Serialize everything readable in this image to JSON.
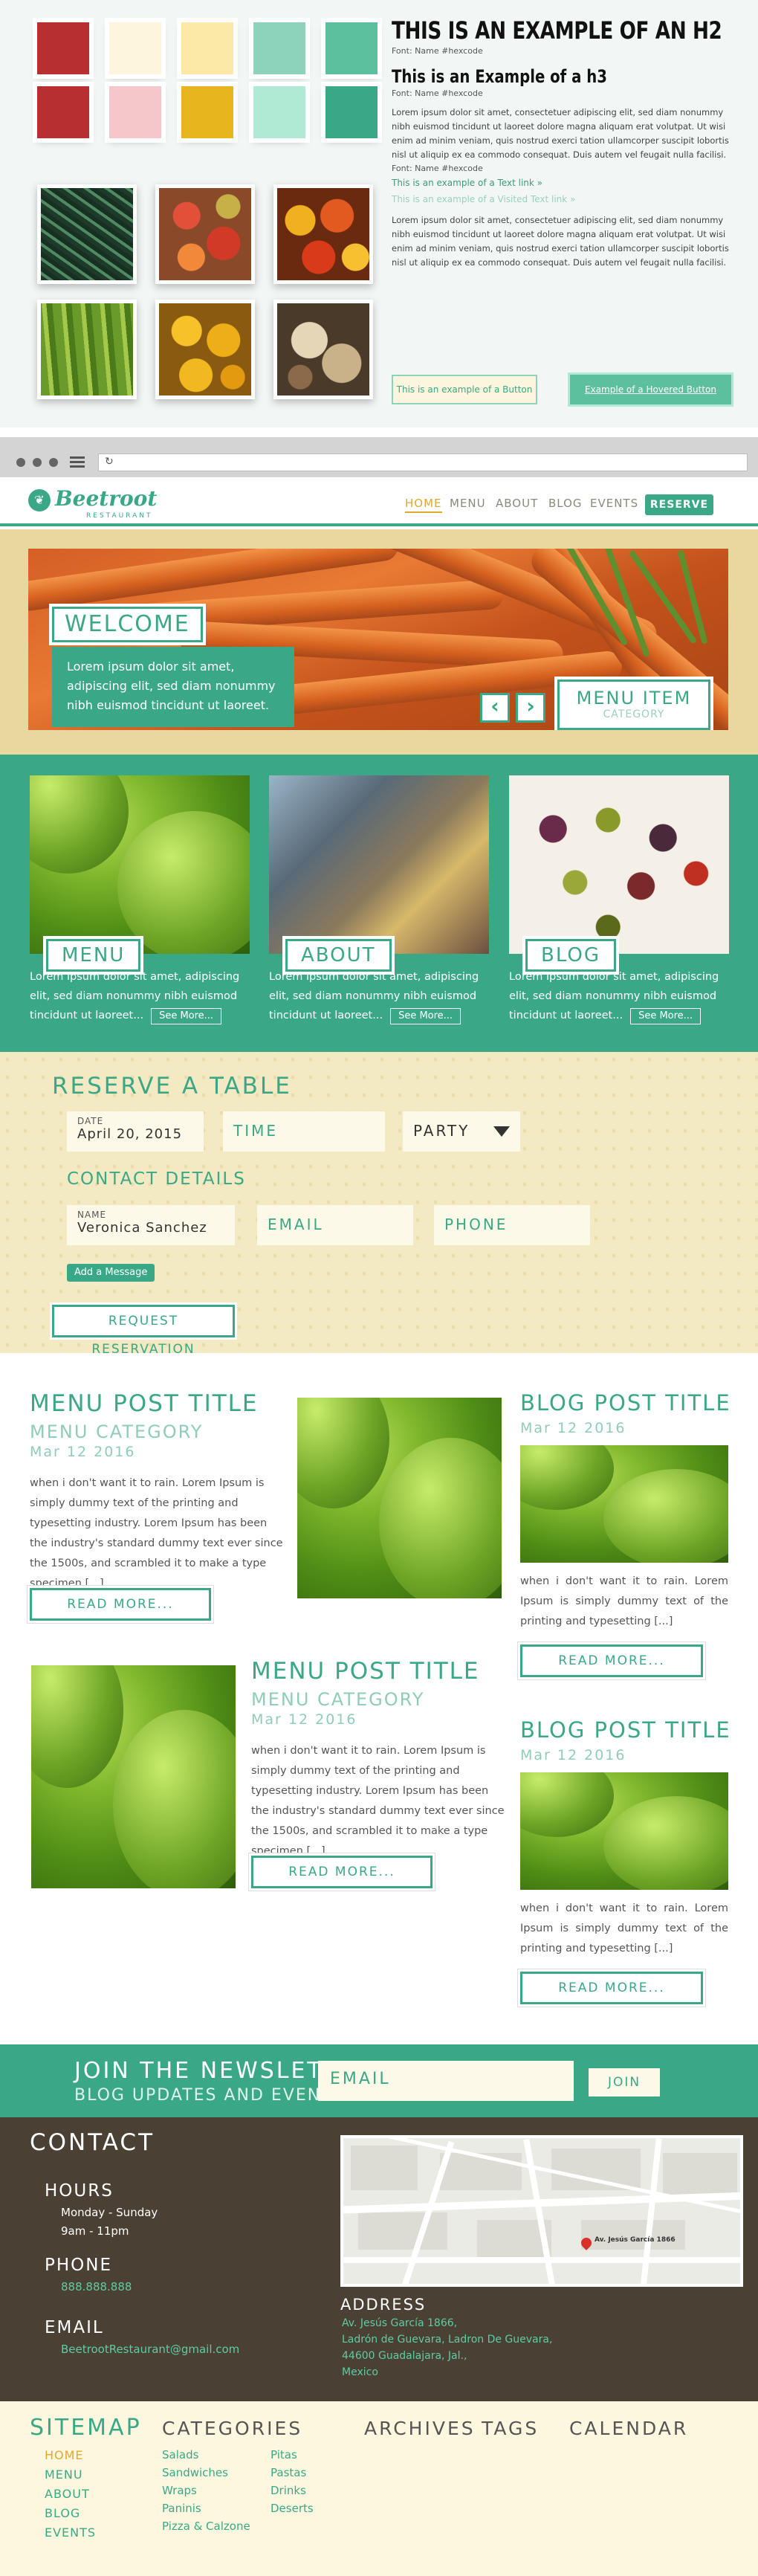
{
  "styleguide": {
    "swatches_top": [
      "#b73030",
      "#fdf5dd",
      "#fde9a7",
      "#8dd3bb",
      "#5cbf9d"
    ],
    "swatches_bottom": [
      "#b73030",
      "#f5c7cb",
      "#e7b61e",
      "#b0e9d4",
      "#3aa886"
    ],
    "h2": "THIS IS AN EXAMPLE OF AN H2",
    "h2_font": "Font: Name #hexcode",
    "h3": "This is an Example of a h3",
    "h3_font": "Font: Name #hexcode",
    "paragraph1": "Lorem ipsum dolor sit amet, consectetuer adipiscing elit, sed diam nonummy nibh euismod tincidunt ut laoreet dolore magna aliquam erat volutpat. Ut wisi enim ad minim veniam, quis nostrud exerci tation ullamcorper suscipit lobortis nisl ut aliquip ex ea commodo consequat. Duis autem vel feugait nulla facilisi.",
    "p_font": "Font: Name #hexcode",
    "link": "This is an example of a Text link »",
    "visited_link": "This is an example of a Visited Text link »",
    "paragraph2": "Lorem ipsum dolor sit amet, consectetuer adipiscing elit, sed diam nonummy nibh euismod tincidunt ut laoreet dolore magna aliquam erat volutpat. Ut wisi enim ad minim veniam, quis nostrud exerci tation ullamcorper suscipit lobortis nisl ut aliquip ex ea commodo consequat. Duis autem vel feugait nulla facilisi.",
    "button": "This is an example of a Button",
    "hover_button": "Example of a Hovered Button"
  },
  "browser": {
    "reload_icon": "reload-icon"
  },
  "header": {
    "logo_name": "Beetroot",
    "logo_sub": "RESTAURANT",
    "nav": [
      "HOME",
      "MENU",
      "ABOUT",
      "BLOG",
      "EVENTS"
    ],
    "reserve": "RESERVE"
  },
  "hero": {
    "welcome": "WELCOME",
    "text": "Lorem ipsum dolor sit amet, adipiscing elit, sed diam nonummy nibh euismod tincidunt ut laoreet.",
    "prev_icon": "chevron-left-icon",
    "next_icon": "chevron-right-icon",
    "menu_item_title": "MENU ITEM",
    "menu_item_category": "CATEGORY"
  },
  "features": [
    {
      "label": "MENU",
      "text": "Lorem ipsum dolor sit amet, adipiscing elit, sed diam nonummy nibh euismod tincidunt ut laoreet...",
      "more": "See More..."
    },
    {
      "label": "ABOUT",
      "text": "Lorem ipsum dolor sit amet, adipiscing elit, sed diam nonummy nibh euismod tincidunt ut laoreet...",
      "more": "See More..."
    },
    {
      "label": "BLOG",
      "text": "Lorem ipsum dolor sit amet, adipiscing elit, sed diam nonummy nibh euismod tincidunt ut laoreet...",
      "more": "See More..."
    }
  ],
  "reserve": {
    "title": "RESERVE A TABLE",
    "date_label": "DATE",
    "date_value": "April 20, 2015",
    "time_placeholder": "TIME",
    "party_placeholder": "PARTY",
    "contact_title": "CONTACT DETAILS",
    "name_label": "NAME",
    "name_value": "Veronica Sanchez",
    "email_placeholder": "EMAIL",
    "phone_placeholder": "PHONE",
    "add_message": "Add a Message",
    "request": "REQUEST RESERVATION"
  },
  "posts": {
    "menu1": {
      "title": "MENU POST TITLE",
      "category": "MENU CATEGORY",
      "date": "Mar 12 2016",
      "body": "when i don't want it to rain. Lorem Ipsum is simply dummy text of the printing and typesetting industry. Lorem Ipsum has been the industry's standard dummy text ever since the 1500s, and scrambled it to make a type specimen [...]",
      "more": "READ MORE..."
    },
    "menu2": {
      "title": "MENU POST TITLE",
      "category": "MENU CATEGORY",
      "date": "Mar 12 2016",
      "body": "when i don't want it to rain. Lorem Ipsum is simply dummy text of the printing and typesetting industry. Lorem Ipsum has been the industry's standard dummy text ever since the 1500s, and scrambled it to make a type specimen [...]",
      "more": "READ MORE..."
    },
    "blog1": {
      "title": "BLOG POST TITLE",
      "date": "Mar 12 2016",
      "body": "when i don't want it to rain. Lorem Ipsum is simply dummy text of the printing and typesetting [...]",
      "more": "READ MORE..."
    },
    "blog2": {
      "title": "BLOG POST TITLE",
      "date": "Mar 12 2016",
      "body": "when i don't want it to rain. Lorem Ipsum is simply dummy text of the printing and typesetting [...]",
      "more": "READ MORE..."
    }
  },
  "newsletter": {
    "title": "JOIN THE NEWSLETTER",
    "subtitle": "BLOG UPDATES AND EVENTS",
    "email_placeholder": "EMAIL",
    "join": "JOIN"
  },
  "contact": {
    "title": "CONTACT",
    "hours_title": "HOURS",
    "hours_days": "Monday - Sunday",
    "hours_time": "9am - 11pm",
    "phone_title": "PHONE",
    "phone": "888.888.888",
    "email_title": "EMAIL",
    "email": "BeetrootRestaurant@gmail.com",
    "address_title": "ADDRESS",
    "address": [
      "Av. Jesús García 1866,",
      "Ladrón de Guevara, Ladron De Guevara,",
      "44600 Guadalajara, Jal.,",
      "Mexico"
    ],
    "map_label": "Av. Jesús García 1866"
  },
  "footer": {
    "sitemap": "SITEMAP",
    "sitemap_links": [
      "HOME",
      "MENU",
      "ABOUT",
      "BLOG",
      "EVENTS"
    ],
    "categories": "CATEGORIES",
    "categories_col1": [
      "Salads",
      "Sandwiches",
      "Wraps",
      "Paninis",
      "Pizza & Calzone"
    ],
    "categories_col2": [
      "Pitas",
      "Pastas",
      "Drinks",
      "Deserts"
    ],
    "archives": "ARCHIVES",
    "tags": "TAGS",
    "calendar": "CALENDAR"
  },
  "colors": {
    "accent": "#3aa886",
    "highlight": "#e0a82e",
    "cream": "#f3e9c3",
    "dark": "#4a4033"
  }
}
